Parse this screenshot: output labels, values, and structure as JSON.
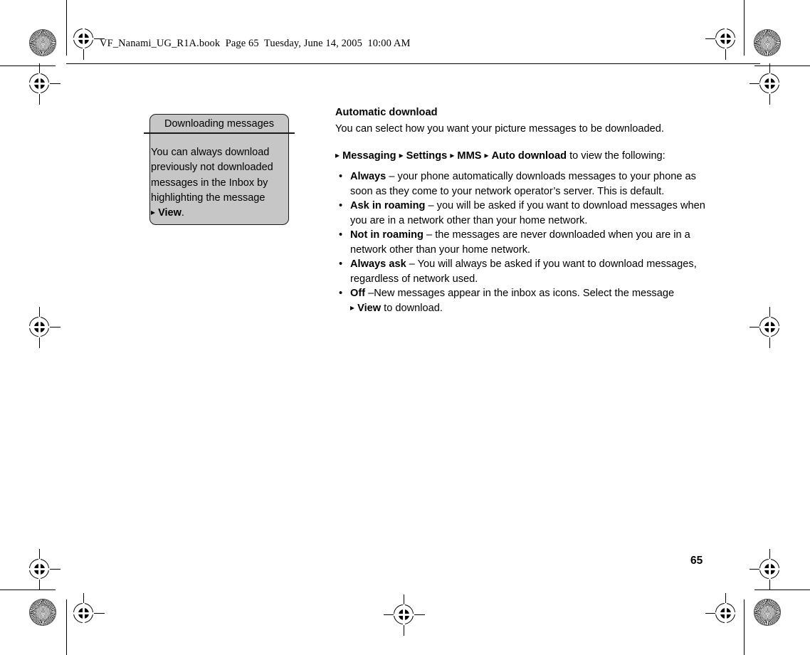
{
  "header": {
    "running_head": "VF_Nanami_UG_R1A.book  Page 65  Tuesday, June 14, 2005  10:00 AM"
  },
  "note_box": {
    "title": "Downloading messages",
    "body_prefix": "You can always download previously not downloaded messages in the Inbox by highlighting the message ",
    "body_marker": "▸",
    "body_bold": "View",
    "body_suffix": "."
  },
  "main": {
    "heading": "Automatic download",
    "intro": "You can select how you want your picture messages to be downloaded.",
    "path": {
      "marker": "▸",
      "step1": "Messaging",
      "step2": "Settings",
      "step3": "MMS",
      "step4": "Auto download",
      "tail": " to view the following:"
    },
    "bullet_glyph": "•",
    "options": [
      {
        "term": "Always",
        "desc": " – your phone automatically downloads messages to your phone as soon as they come to your network operator’s server. This is default."
      },
      {
        "term": "Ask in roaming",
        "desc": " – you will be asked if you want to download messages when you are in a network other than your home network."
      },
      {
        "term": "Not in roaming",
        "desc": " – the messages are never downloaded when you are in a network other than your home network."
      },
      {
        "term": "Always ask",
        "desc": " – You will always be asked if you want to download messages, regardless of network used."
      },
      {
        "term": "Off",
        "desc_before": " –New messages appear in the inbox as icons. Select the message ",
        "marker": "▸",
        "link": "View",
        "desc_after": " to download."
      }
    ]
  },
  "folio": {
    "page_number": "65"
  },
  "colors": {
    "note_fill": "#c6c6c6",
    "ink": "#000000",
    "page": "#ffffff"
  }
}
